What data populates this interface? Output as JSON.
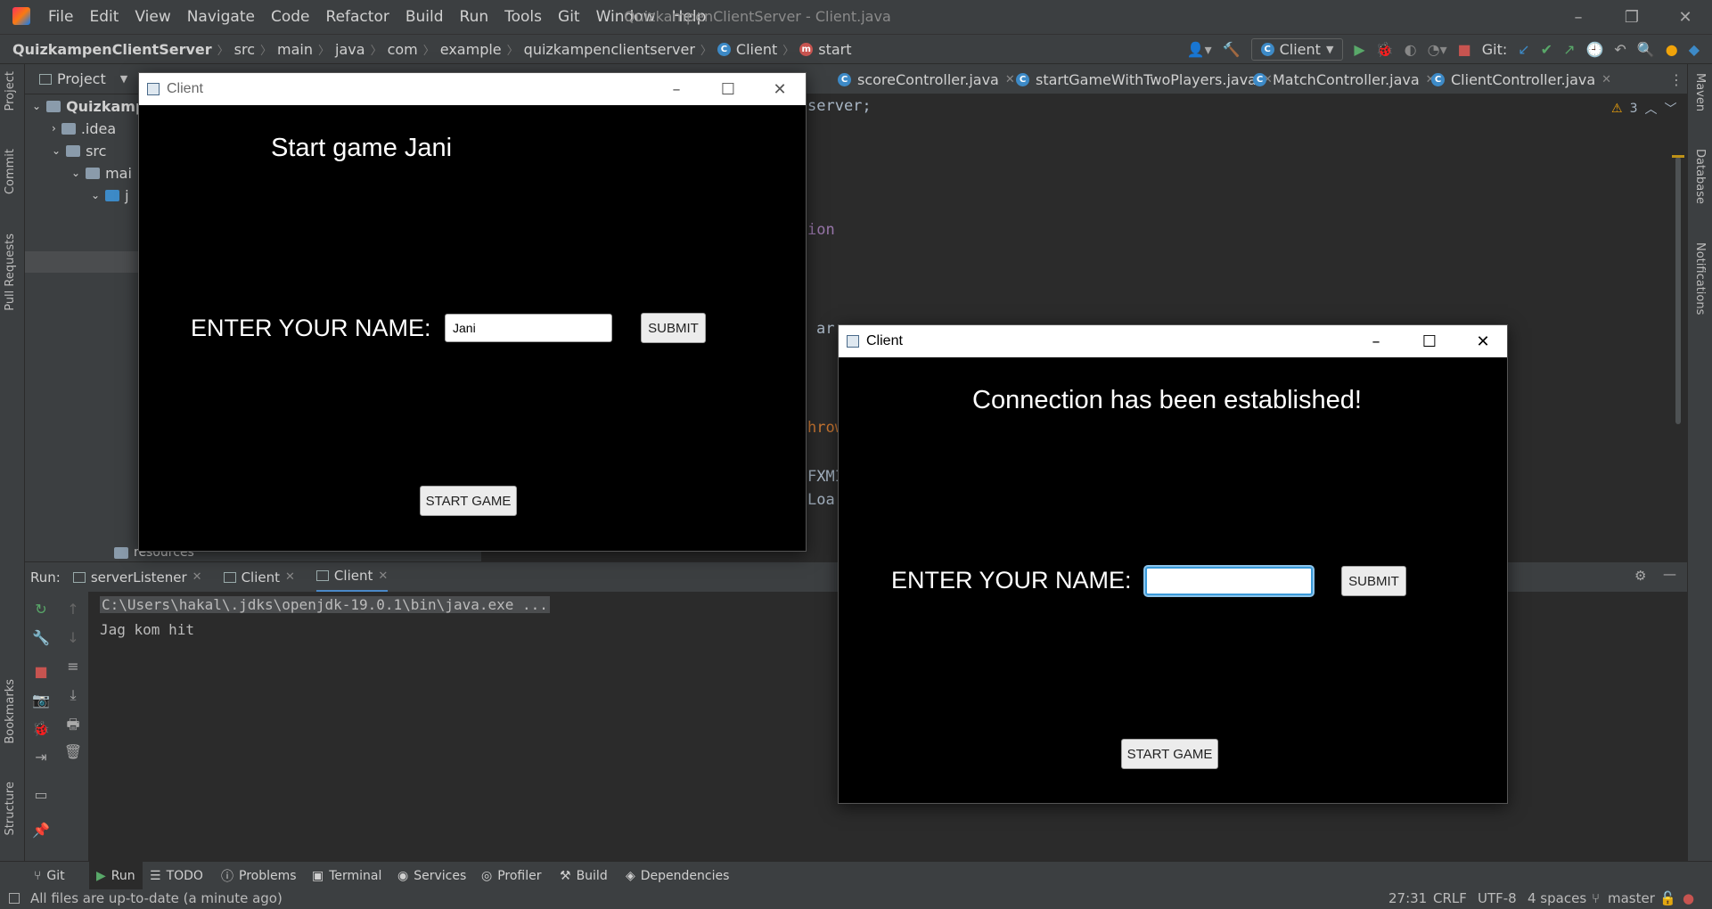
{
  "ide": {
    "app_title": "QuizkampenClientServer - Client.java",
    "menu": [
      "File",
      "Edit",
      "View",
      "Navigate",
      "Code",
      "Refactor",
      "Build",
      "Run",
      "Tools",
      "Git",
      "Window",
      "Help"
    ],
    "breadcrumbs": [
      "QuizkampenClientServer",
      "src",
      "main",
      "java",
      "com",
      "example",
      "quizkampenclientserver",
      "Client",
      "start"
    ],
    "run_config": "Client",
    "git_label": "Git:",
    "editor_tabs": [
      "scoreController.java",
      "startGameWithTwoPlayers.java",
      "MatchController.java",
      "ClientController.java"
    ],
    "warnings_count": "3",
    "code_lines": [
      {
        "text": "server;",
        "color": "#a9b7c6"
      },
      {
        "text": "ion",
        "color": "#9876aa"
      },
      {
        "text": "ar",
        "color": "#a9b7c6"
      },
      {
        "text": "hrow",
        "color": "#cc7832"
      },
      {
        "text": "FXMI",
        "color": "#a9b7c6"
      },
      {
        "text": "Loa",
        "color": "#a9b7c6"
      }
    ]
  },
  "project_panel": {
    "title": "Project",
    "tree": [
      {
        "label": "Quizkampe",
        "level": 0
      },
      {
        "label": ".idea",
        "level": 1
      },
      {
        "label": "src",
        "level": 1
      },
      {
        "label": "mai",
        "level": 2
      },
      {
        "label": "j",
        "level": 3
      }
    ],
    "resources_label": "resources"
  },
  "left_strip": [
    "Project",
    "Commit",
    "Pull Requests",
    "Bookmarks",
    "Structure"
  ],
  "right_strip": [
    "Maven",
    "Database",
    "Notifications"
  ],
  "run_panel": {
    "label": "Run:",
    "tabs": [
      "serverListener",
      "Client",
      "Client"
    ],
    "console_lines": [
      "C:\\Users\\hakal\\.jdks\\openjdk-19.0.1\\bin\\java.exe ...",
      "Jag kom hit"
    ]
  },
  "bottom_tools": [
    "Git",
    "Run",
    "TODO",
    "Problems",
    "Terminal",
    "Services",
    "Profiler",
    "Build",
    "Dependencies"
  ],
  "status": {
    "message": "All files are up-to-date (a minute ago)",
    "position": "27:31",
    "line_sep": "CRLF",
    "encoding": "UTF-8",
    "indent": "4 spaces",
    "branch": "master"
  },
  "client_window_1": {
    "title": "Client",
    "heading": "Start game Jani",
    "name_label": "ENTER YOUR NAME:",
    "name_value": "Jani",
    "submit_label": "SUBMIT",
    "start_label": "START GAME"
  },
  "client_window_2": {
    "title": "Client",
    "heading": "Connection has been established!",
    "name_label": "ENTER YOUR NAME:",
    "name_value": "",
    "submit_label": "SUBMIT",
    "start_label": "START GAME"
  }
}
